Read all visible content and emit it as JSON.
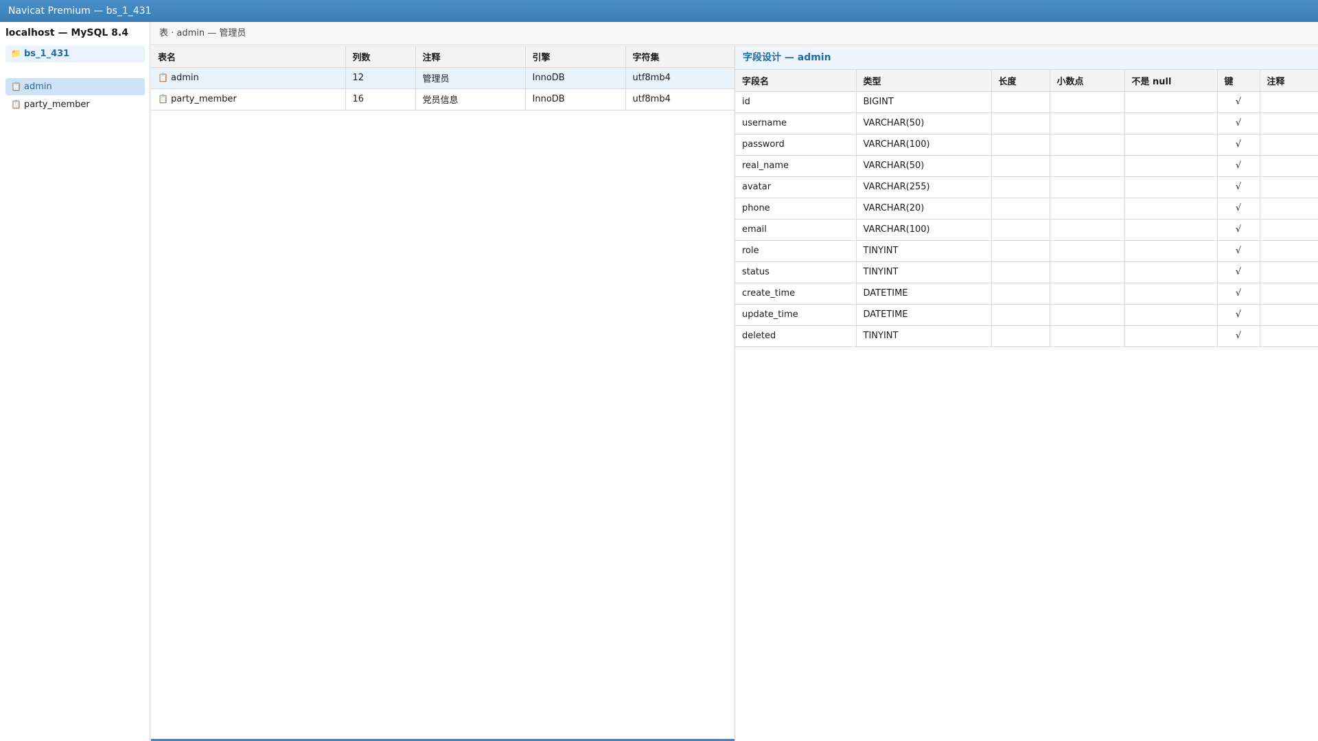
{
  "window": {
    "title": "Navicat Premium — bs_1_431"
  },
  "sidebar": {
    "server": "localhost — MySQL 8.4",
    "database": {
      "icon": "folder-icon",
      "label": "bs_1_431"
    },
    "tables": [
      {
        "icon": "table-icon",
        "label": "admin",
        "selected": true
      },
      {
        "icon": "table-icon",
        "label": "party_member",
        "selected": false
      }
    ]
  },
  "breadcrumb": "表 · admin — 管理员",
  "tables_list": {
    "columns": [
      "表名",
      "列数",
      "注释",
      "引擎",
      "字符集"
    ],
    "rows": [
      {
        "name": "admin",
        "count": "12",
        "comment": "管理员",
        "engine": "InnoDB",
        "charset": "utf8mb4"
      },
      {
        "name": "party_member",
        "count": "16",
        "comment": "党员信息",
        "engine": "InnoDB",
        "charset": "utf8mb4"
      }
    ]
  },
  "field_design": {
    "title": "字段设计 — admin",
    "columns": [
      "字段名",
      "类型",
      "长度",
      "小数点",
      "不是 null",
      "键",
      "注释"
    ],
    "rows": [
      {
        "name": "id",
        "type": "BIGINT",
        "key": "√"
      },
      {
        "name": "username",
        "type": "VARCHAR(50)",
        "key": "√"
      },
      {
        "name": "password",
        "type": "VARCHAR(100)",
        "key": "√"
      },
      {
        "name": "real_name",
        "type": "VARCHAR(50)",
        "key": "√"
      },
      {
        "name": "avatar",
        "type": "VARCHAR(255)",
        "key": "√"
      },
      {
        "name": "phone",
        "type": "VARCHAR(20)",
        "key": "√"
      },
      {
        "name": "email",
        "type": "VARCHAR(100)",
        "key": "√"
      },
      {
        "name": "role",
        "type": "TINYINT",
        "key": "√"
      },
      {
        "name": "status",
        "type": "TINYINT",
        "key": "√"
      },
      {
        "name": "create_time",
        "type": "DATETIME",
        "key": "√"
      },
      {
        "name": "update_time",
        "type": "DATETIME",
        "key": "√"
      },
      {
        "name": "deleted",
        "type": "TINYINT",
        "key": "√"
      }
    ]
  },
  "colors": {
    "titlebar": "#3a7db6",
    "accent": "#1f6aa8",
    "selection": "#cde3f5"
  }
}
